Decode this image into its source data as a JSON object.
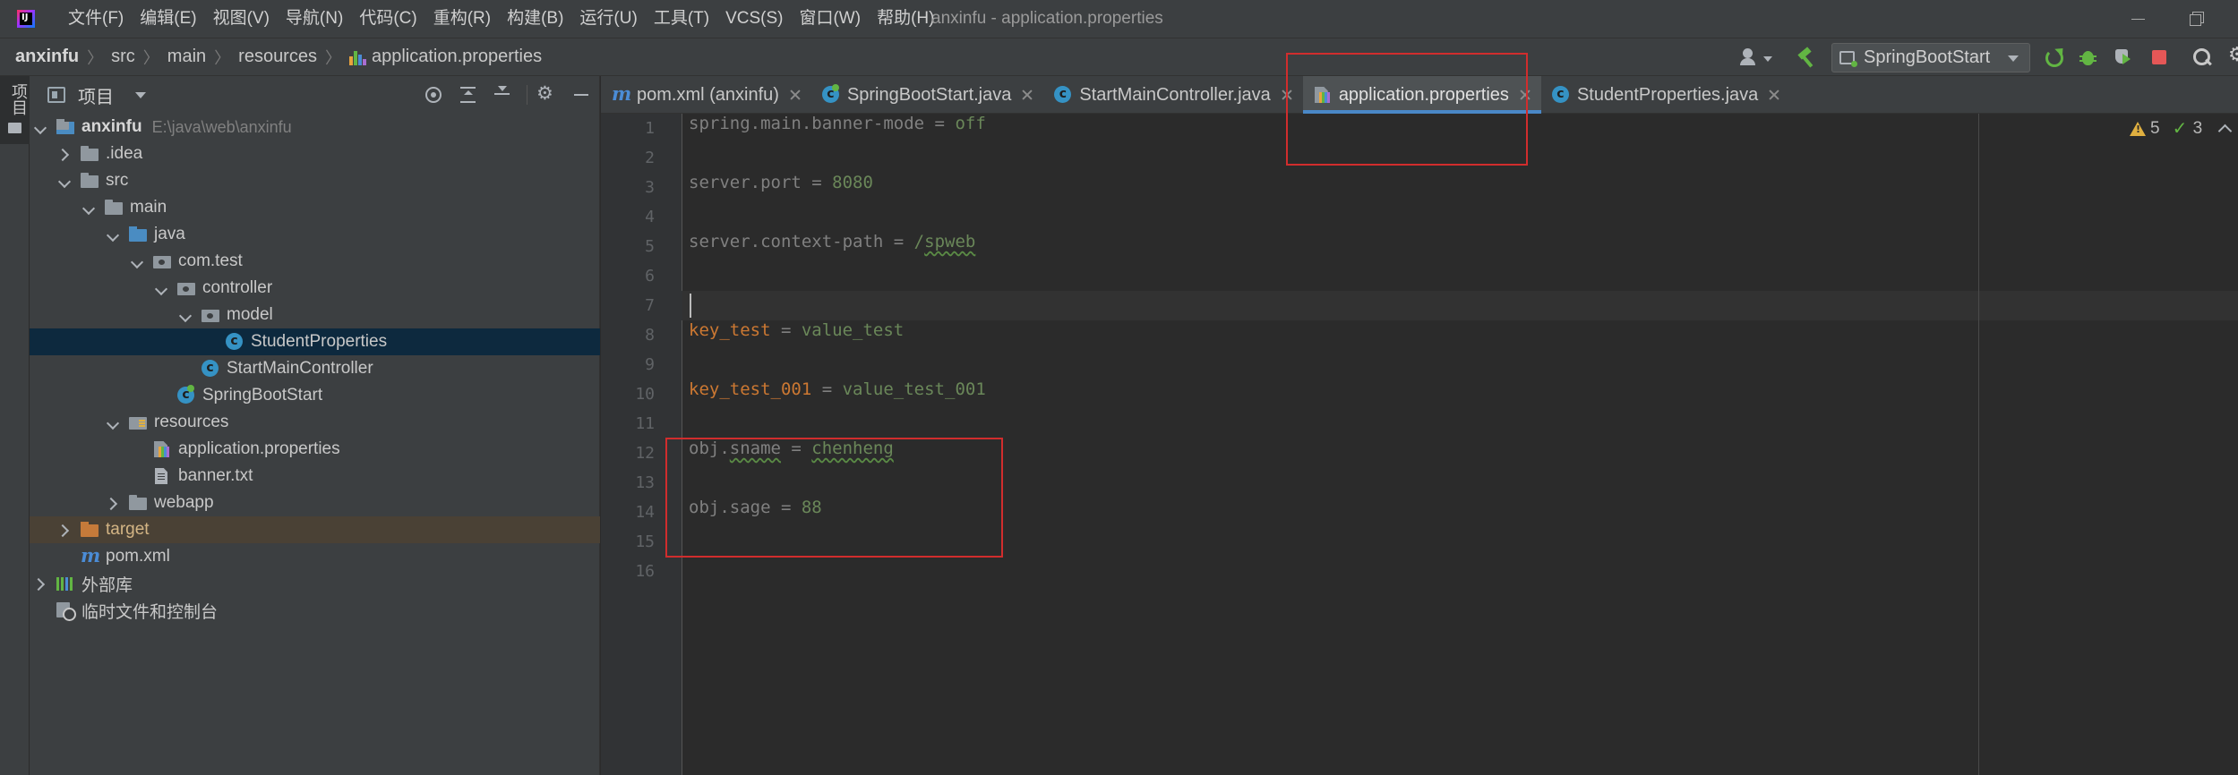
{
  "titlebar": {
    "menu": [
      "文件(F)",
      "编辑(E)",
      "视图(V)",
      "导航(N)",
      "代码(C)",
      "重构(R)",
      "构建(B)",
      "运行(U)",
      "工具(T)",
      "VCS(S)",
      "窗口(W)",
      "帮助(H)"
    ],
    "window_title": "anxinfu - application.properties"
  },
  "navbar": {
    "breadcrumbs": [
      "anxinfu",
      "src",
      "main",
      "resources",
      "application.properties"
    ],
    "run_config": "SpringBootStart"
  },
  "stripe": {
    "label": "项目"
  },
  "project": {
    "title": "项目",
    "tree": [
      {
        "label": "anxinfu",
        "hint": "E:\\java\\web\\anxinfu",
        "depth": 0,
        "arrow": "open",
        "icon": "module-icon",
        "bold": true
      },
      {
        "label": ".idea",
        "depth": 1,
        "arrow": "closed",
        "icon": "folder-icon"
      },
      {
        "label": "src",
        "depth": 1,
        "arrow": "open",
        "icon": "folder-icon"
      },
      {
        "label": "main",
        "depth": 2,
        "arrow": "open",
        "icon": "folder-icon"
      },
      {
        "label": "java",
        "depth": 3,
        "arrow": "open",
        "icon": "folder-src-icon"
      },
      {
        "label": "com.test",
        "depth": 4,
        "arrow": "open",
        "icon": "package-icon"
      },
      {
        "label": "controller",
        "depth": 5,
        "arrow": "open",
        "icon": "package-icon"
      },
      {
        "label": "model",
        "depth": 6,
        "arrow": "open",
        "icon": "package-icon"
      },
      {
        "label": "StudentProperties",
        "depth": 7,
        "arrow": "none",
        "icon": "class-icon",
        "selected": true
      },
      {
        "label": "StartMainController",
        "depth": 6,
        "arrow": "none",
        "icon": "class-icon"
      },
      {
        "label": "SpringBootStart",
        "depth": 5,
        "arrow": "none",
        "icon": "springclass-icon"
      },
      {
        "label": "resources",
        "depth": 3,
        "arrow": "open",
        "icon": "resources-icon"
      },
      {
        "label": "application.properties",
        "depth": 4,
        "arrow": "none",
        "icon": "propsfile-icon"
      },
      {
        "label": "banner.txt",
        "depth": 4,
        "arrow": "none",
        "icon": "txt-icon"
      },
      {
        "label": "webapp",
        "depth": 3,
        "arrow": "closed",
        "icon": "folder-icon"
      },
      {
        "label": "target",
        "depth": 1,
        "arrow": "closed",
        "icon": "folder-orange-icon",
        "excluded": true
      },
      {
        "label": "pom.xml",
        "depth": 1,
        "arrow": "none",
        "icon": "maven-icon"
      },
      {
        "label": "外部库",
        "depth": 0,
        "arrow": "closed",
        "icon": "lib-icon"
      },
      {
        "label": "临时文件和控制台",
        "depth": 0,
        "arrow": "none",
        "icon": "scratch-icon"
      }
    ]
  },
  "tabs": [
    {
      "label": "pom.xml (anxinfu)",
      "icon": "maven-icon",
      "active": false
    },
    {
      "label": "SpringBootStart.java",
      "icon": "springclass-icon",
      "active": false
    },
    {
      "label": "StartMainController.java",
      "icon": "class-icon",
      "active": false
    },
    {
      "label": "application.properties",
      "icon": "propsfile-icon",
      "active": true
    },
    {
      "label": "StudentProperties.java",
      "icon": "class-icon",
      "active": false
    }
  ],
  "editor": {
    "line_numbers": [
      "1",
      "2",
      "3",
      "4",
      "5",
      "6",
      "7",
      "8",
      "9",
      "10",
      "11",
      "12",
      "13",
      "14",
      "15",
      "16"
    ],
    "lines": [
      [
        {
          "t": "spring.main.banner-mode",
          "c": "k-dim"
        },
        {
          "t": " = ",
          "c": "k-eq"
        },
        {
          "t": "off",
          "c": "k-val"
        }
      ],
      [],
      [
        {
          "t": "server.port",
          "c": "k-dim"
        },
        {
          "t": " = ",
          "c": "k-eq"
        },
        {
          "t": "8080",
          "c": "k-val"
        }
      ],
      [],
      [
        {
          "t": "server.context-path",
          "c": "k-dim"
        },
        {
          "t": " = ",
          "c": "k-eq"
        },
        {
          "t": "/",
          "c": "k-val"
        },
        {
          "t": "spweb",
          "c": "k-val squig"
        }
      ],
      [],
      [],
      [
        {
          "t": "key_test",
          "c": "k-key"
        },
        {
          "t": " = ",
          "c": "k-eq"
        },
        {
          "t": "value_test",
          "c": "k-val"
        }
      ],
      [],
      [
        {
          "t": "key_test_001",
          "c": "k-key"
        },
        {
          "t": " = ",
          "c": "k-eq"
        },
        {
          "t": "value_test_001",
          "c": "k-val"
        }
      ],
      [],
      [
        {
          "t": "obj.",
          "c": "k-dim"
        },
        {
          "t": "sname",
          "c": "k-dim squig"
        },
        {
          "t": " = ",
          "c": "k-eq"
        },
        {
          "t": "chenheng",
          "c": "k-val squig"
        }
      ],
      [],
      [
        {
          "t": "obj.sage",
          "c": "k-dim"
        },
        {
          "t": " = ",
          "c": "k-eq"
        },
        {
          "t": "88",
          "c": "k-val"
        }
      ],
      [],
      []
    ],
    "warnings": "5",
    "passed": "3"
  },
  "colors": {
    "accent": "#4a88c7",
    "annotation": "#d12d2d",
    "key": "#cc7832",
    "value": "#6a8759"
  }
}
